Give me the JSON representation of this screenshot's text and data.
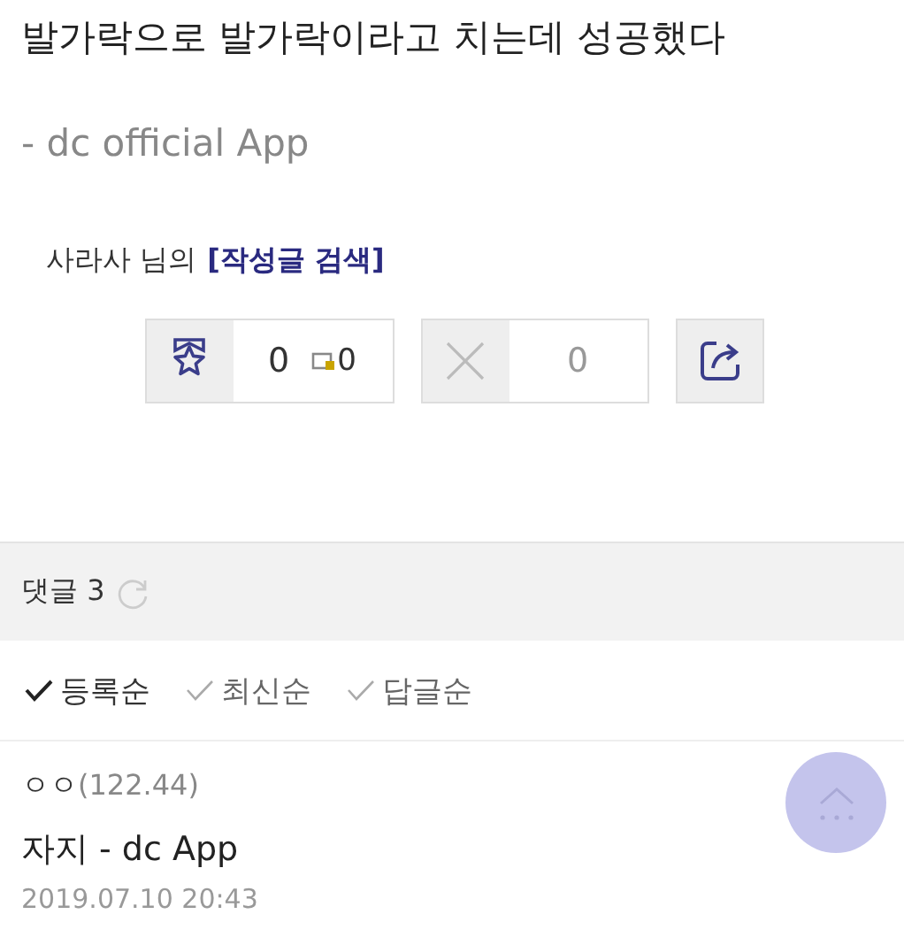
{
  "post": {
    "title": "발가락으로 발가락이라고 치는데 성공했다",
    "source": "- dc official App",
    "author": "사라사 님의",
    "search_link": "[작성글 검색]"
  },
  "votes": {
    "recommend": "0",
    "fixed_recommend": "0",
    "downvote": "0"
  },
  "comments": {
    "label": "댓글 3",
    "sort_options": [
      {
        "label": "등록순",
        "selected": true
      },
      {
        "label": "최신순",
        "selected": false
      },
      {
        "label": "답글순",
        "selected": false
      }
    ],
    "items": [
      {
        "nickname": "ㅇㅇ",
        "ip": "(122.44)",
        "text": "자지 - dc App",
        "date": "2019.07.10 20:43"
      }
    ]
  }
}
